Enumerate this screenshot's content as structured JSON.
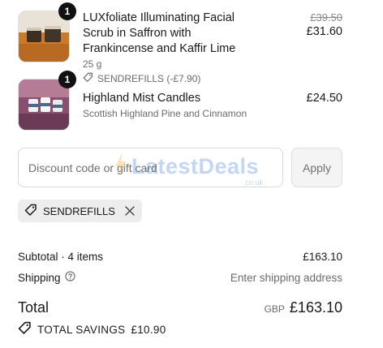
{
  "items": [
    {
      "quantity": "1",
      "title": "LUXfoliate Illuminating Facial Scrub in Saffron with Frankincense and Kaffir Lime",
      "variant": "25 g",
      "discount": "SENDREFILLS (-£7.90)",
      "compare_price": "£39.50",
      "price": "£31.60",
      "thumb_icon": "scrub-jars-image"
    },
    {
      "quantity": "1",
      "title": "Highland Mist Candles",
      "variant": "Scottish Highland Pine and Cinnamon",
      "price": "£24.50",
      "thumb_icon": "candles-image"
    }
  ],
  "discount": {
    "placeholder": "Discount code or gift card",
    "apply_label": "Apply",
    "applied_code": "SENDREFILLS"
  },
  "watermark": {
    "text": "LatestDeals",
    "sub": ".co.uk"
  },
  "summary": {
    "subtotal_label": "Subtotal · 4 items",
    "subtotal_value": "£163.10",
    "shipping_label": "Shipping",
    "shipping_value": "Enter shipping address",
    "total_label": "Total",
    "currency": "GBP",
    "total_value": "£163.10",
    "savings_label": "TOTAL SAVINGS",
    "savings_value": "£10.90"
  },
  "colors": {
    "text": "#1a1a1a",
    "muted": "#6b6b6b",
    "badge": "#111111",
    "chip_bg": "#ededed"
  }
}
